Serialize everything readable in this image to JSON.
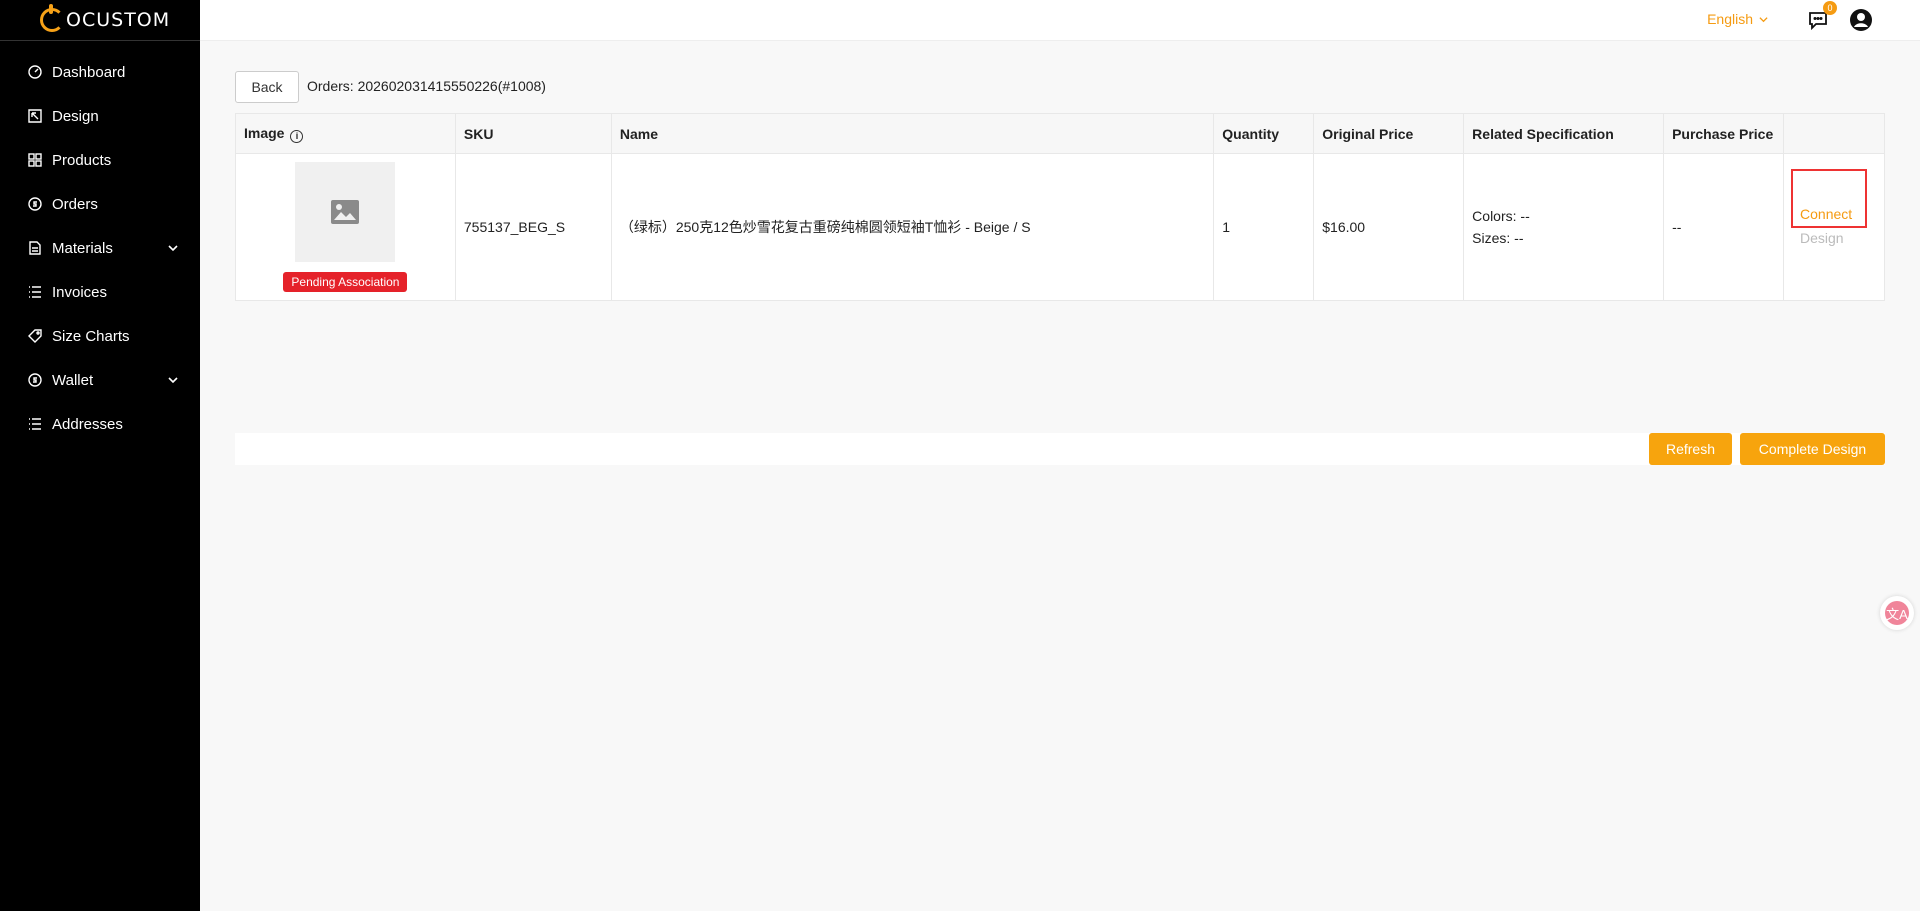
{
  "brand": {
    "logo_text": "OCUSTOM",
    "accent_color": "#f59b12"
  },
  "sidebar": {
    "items": [
      {
        "label": "Dashboard",
        "icon": "dashboard-icon"
      },
      {
        "label": "Design",
        "icon": "design-icon"
      },
      {
        "label": "Products",
        "icon": "products-icon"
      },
      {
        "label": "Orders",
        "icon": "orders-icon"
      },
      {
        "label": "Materials",
        "icon": "materials-icon",
        "expandable": true
      },
      {
        "label": "Invoices",
        "icon": "invoices-icon"
      },
      {
        "label": "Size Charts",
        "icon": "size-charts-icon"
      },
      {
        "label": "Wallet",
        "icon": "wallet-icon",
        "expandable": true
      },
      {
        "label": "Addresses",
        "icon": "addresses-icon"
      }
    ]
  },
  "topbar": {
    "language": "English",
    "message_count": "0"
  },
  "page": {
    "back_label": "Back",
    "order_title": "Orders: 202602031415550226(#1008)"
  },
  "table": {
    "headers": [
      "Image",
      "SKU",
      "Name",
      "Quantity",
      "Original Price",
      "Related Specification",
      "Purchase Price",
      ""
    ],
    "rows": [
      {
        "status_badge": "Pending Association",
        "sku": "755137_BEG_S",
        "name": "（绿标）250克12色炒雪花复古重磅纯棉圆领短袖T恤衫 - Beige / S",
        "quantity": "1",
        "original_price": "$16.00",
        "spec_colors": "Colors: --",
        "spec_sizes": "Sizes: --",
        "purchase_price": "--",
        "action_connect": "Connect",
        "action_design": "Design"
      }
    ]
  },
  "footer_actions": {
    "refresh_label": "Refresh",
    "complete_label": "Complete Design"
  },
  "floating": {
    "translate_glyph": "文A"
  }
}
